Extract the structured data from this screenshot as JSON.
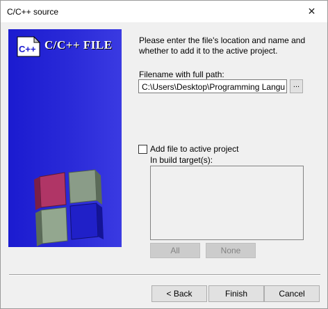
{
  "window": {
    "title": "C/C++ source",
    "close_glyph": "✕"
  },
  "banner": {
    "logo_text": "C++",
    "title": "C/C++ FILE",
    "icon": "cubes-graphic"
  },
  "intro_text": "Please enter the file's location and name and whether to add it to the active project.",
  "filename": {
    "label": "Filename with full path:",
    "value": "C:\\Users\\Desktop\\Programming Langu",
    "browse_label": "..."
  },
  "add_to_project": {
    "label": "Add file to active project",
    "checked": false
  },
  "build_targets": {
    "label": "In build target(s):",
    "items": [],
    "all_label": "All",
    "none_label": "None"
  },
  "buttons": {
    "back": "< Back",
    "finish": "Finish",
    "cancel": "Cancel"
  }
}
